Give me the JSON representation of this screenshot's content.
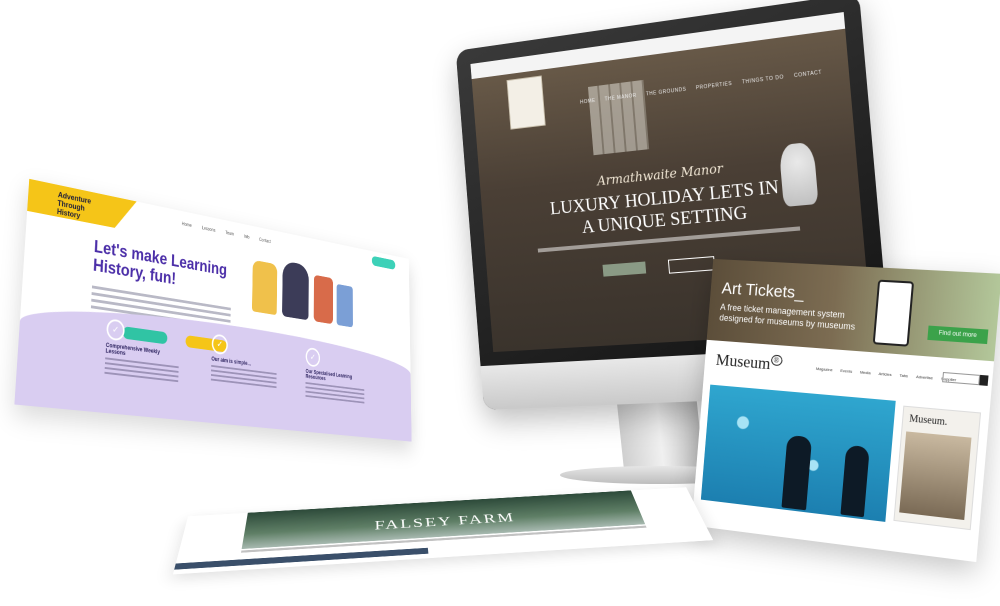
{
  "monitor": {
    "topbar_text": "",
    "nav": [
      "HOME",
      "THE MANOR",
      "THE GROUNDS",
      "PROPERTIES",
      "THINGS TO DO",
      "CONTACT"
    ],
    "script_title": "Armathwaite Manor",
    "headline_line1": "LUXURY HOLIDAY LETS IN",
    "headline_line2": "A UNIQUE SETTING"
  },
  "learning": {
    "logo_text": "Adventure Through History",
    "nav": [
      "Home",
      "Lessons",
      "Team",
      "Info",
      "Contact"
    ],
    "title": "Let's make Learning History, fun!",
    "columns": [
      {
        "heading": "Comprehensive Weekly Lessons"
      },
      {
        "heading": "Our aim is simple..."
      },
      {
        "heading": "Our Specialised Learning Resources"
      }
    ]
  },
  "museum": {
    "banner_title": "Art Tickets_",
    "banner_subtitle": "A free ticket management system designed for museums by museums",
    "banner_tag": "Find out more",
    "logo": "Museum",
    "nav": [
      "Magazine",
      "Events",
      "Media",
      "Articles",
      "Tabs",
      "Advertise",
      "Supplier"
    ],
    "side_title": "Museum."
  },
  "farm": {
    "title": "FALSEY FARM"
  },
  "colors": {
    "learning_accent": "#4b2ea8",
    "learning_yellow": "#f5c518",
    "learning_teal": "#30c4a4",
    "learning_lilac": "#d9cdf1",
    "museum_green": "#3ba24a",
    "museum_blue": "#2fa6cf"
  }
}
